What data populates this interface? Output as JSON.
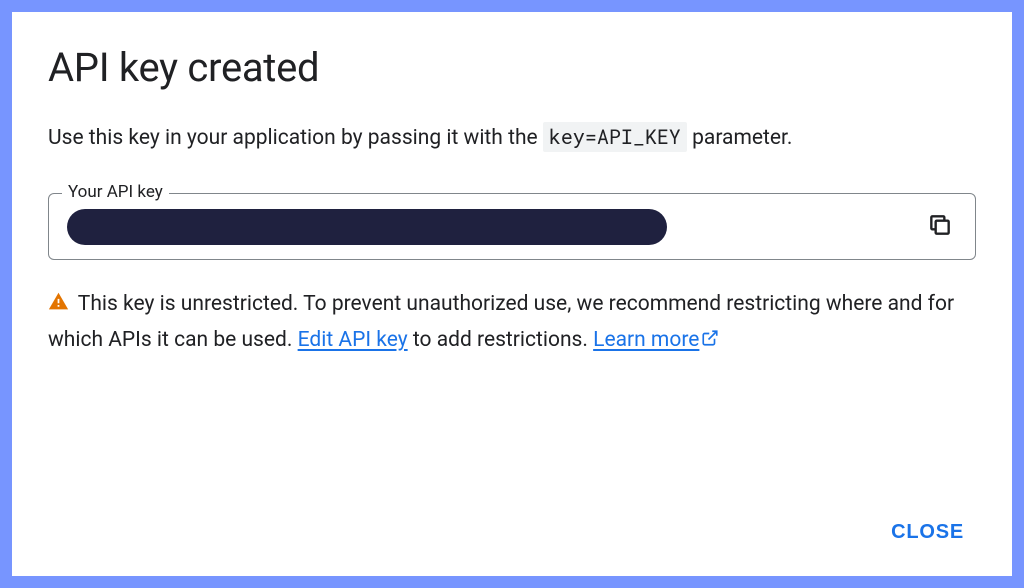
{
  "dialog": {
    "title": "API key created",
    "description_pre": "Use this key in your application by passing it with the ",
    "description_code": "key=API_KEY",
    "description_post": " parameter.",
    "field_label": "Your API key",
    "warning_pre": " This key is unrestricted. To prevent unauthorized use, we recommend restricting where and for which APIs it can be used. ",
    "edit_link": "Edit API key",
    "warning_mid": " to add restrictions. ",
    "learn_more": "Learn more",
    "close_label": "CLOSE"
  },
  "colors": {
    "accent": "#1a73e8",
    "border_frame": "#7795ff",
    "warning": "#e37400",
    "key_mask": "#1f213f"
  }
}
